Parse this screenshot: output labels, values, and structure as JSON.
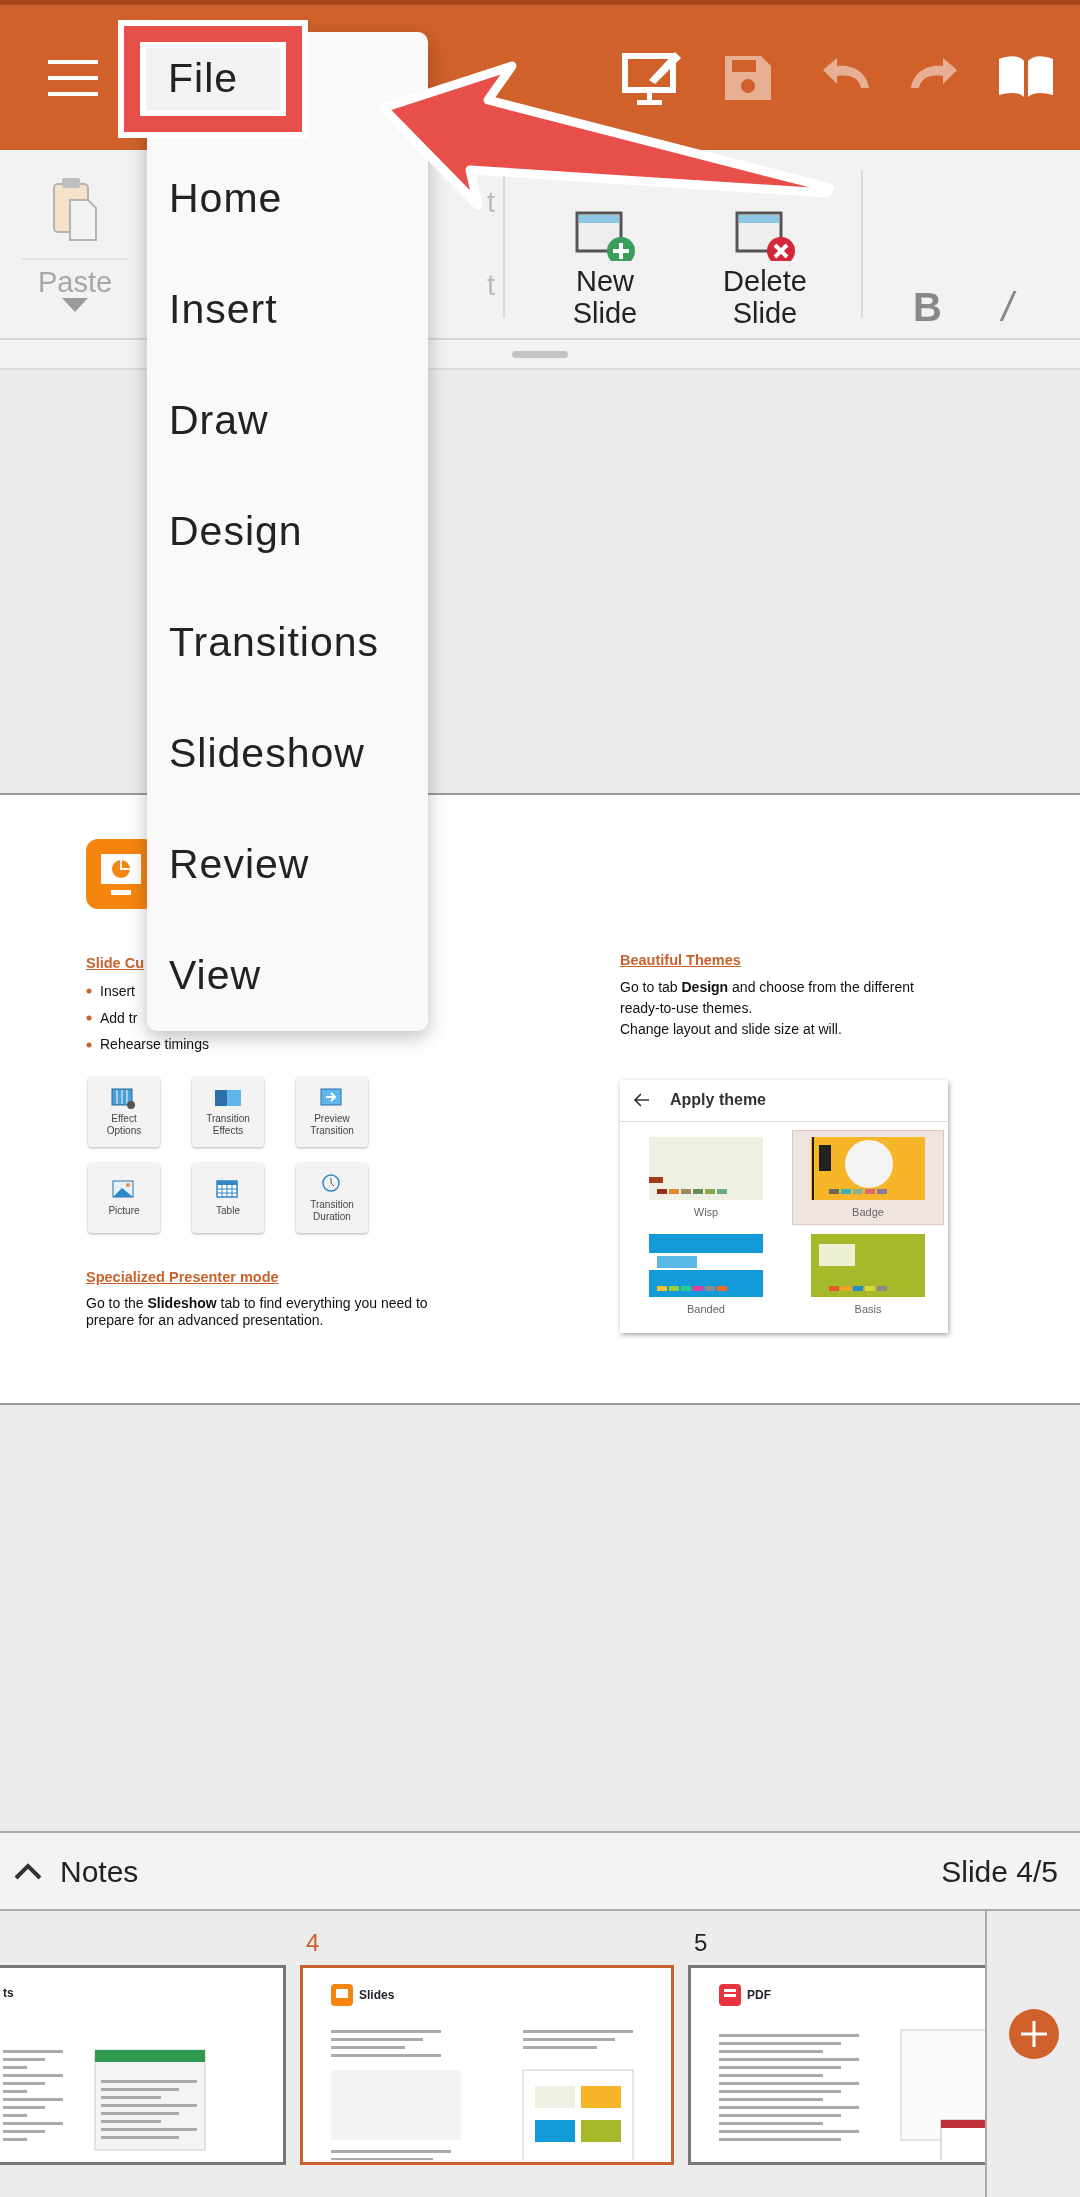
{
  "toolbar": {
    "buttons": [
      {
        "kind": "menu",
        "disabled": false
      },
      {
        "kind": "present-edit",
        "disabled": false
      },
      {
        "kind": "save",
        "disabled": true
      },
      {
        "kind": "undo",
        "disabled": true
      },
      {
        "kind": "redo",
        "disabled": true
      },
      {
        "kind": "book",
        "disabled": false
      }
    ]
  },
  "menu": {
    "items": [
      {
        "label": "File",
        "callout": true
      },
      {
        "label": "Home",
        "callout": false
      },
      {
        "label": "Insert",
        "callout": false
      },
      {
        "label": "Draw",
        "callout": false
      },
      {
        "label": "Design",
        "callout": false
      },
      {
        "label": "Transitions",
        "callout": false
      },
      {
        "label": "Slideshow",
        "callout": false
      },
      {
        "label": "Review",
        "callout": false
      },
      {
        "label": "View",
        "callout": false
      }
    ]
  },
  "ribbon": {
    "paste": {
      "label": "Paste",
      "disabled": true
    },
    "covered_labels": [
      "t",
      "t"
    ],
    "buttons": [
      {
        "label": "New Slide",
        "kind": "new"
      },
      {
        "label": "Delete Slide",
        "kind": "delete"
      }
    ],
    "format": [
      {
        "label": "B",
        "kind": "bold"
      },
      {
        "label": "/",
        "kind": "italic"
      }
    ]
  },
  "slide": {
    "left": {
      "heading": "Slide Cu",
      "bullets": [
        "Insert",
        "Add tr",
        "Rehearse timings"
      ],
      "tiles": [
        {
          "label": "Effect Options",
          "kind": "effect"
        },
        {
          "label": "Transition Effects",
          "kind": "transition"
        },
        {
          "label": "Preview Transition",
          "kind": "preview"
        },
        {
          "label": "Picture",
          "kind": "picture"
        },
        {
          "label": "Table",
          "kind": "table"
        },
        {
          "label": "Transition Duration",
          "kind": "clock"
        }
      ],
      "heading2": "Specialized Presenter mode",
      "text2": "Go to the **Slideshow** tab to find everything you need to prepare for an advanced presentation."
    },
    "right": {
      "heading": "Beautiful Themes",
      "lines": [
        "Go to tab **Design** and choose from the different",
        "ready-to-use themes.",
        "Change layout and slide size at will."
      ],
      "dialog": {
        "title": "Apply theme",
        "themes": [
          {
            "name": "Wisp",
            "kind": "wisp",
            "selected": false
          },
          {
            "name": "Badge",
            "kind": "badge",
            "selected": true
          },
          {
            "name": "Banded",
            "kind": "banded",
            "selected": false
          },
          {
            "name": "Basis",
            "kind": "basis",
            "selected": false
          }
        ]
      }
    }
  },
  "notes_bar": {
    "label": "Notes",
    "expanded": false,
    "indicator": "Slide 4/5"
  },
  "thumbnails": [
    {
      "title": "ts",
      "kind": "sheet",
      "selected": false
    },
    {
      "number": "4",
      "title": "Slides",
      "kind": "slides",
      "selected": true
    },
    {
      "number": "5",
      "title": "PDF",
      "kind": "pdf",
      "selected": false
    }
  ]
}
